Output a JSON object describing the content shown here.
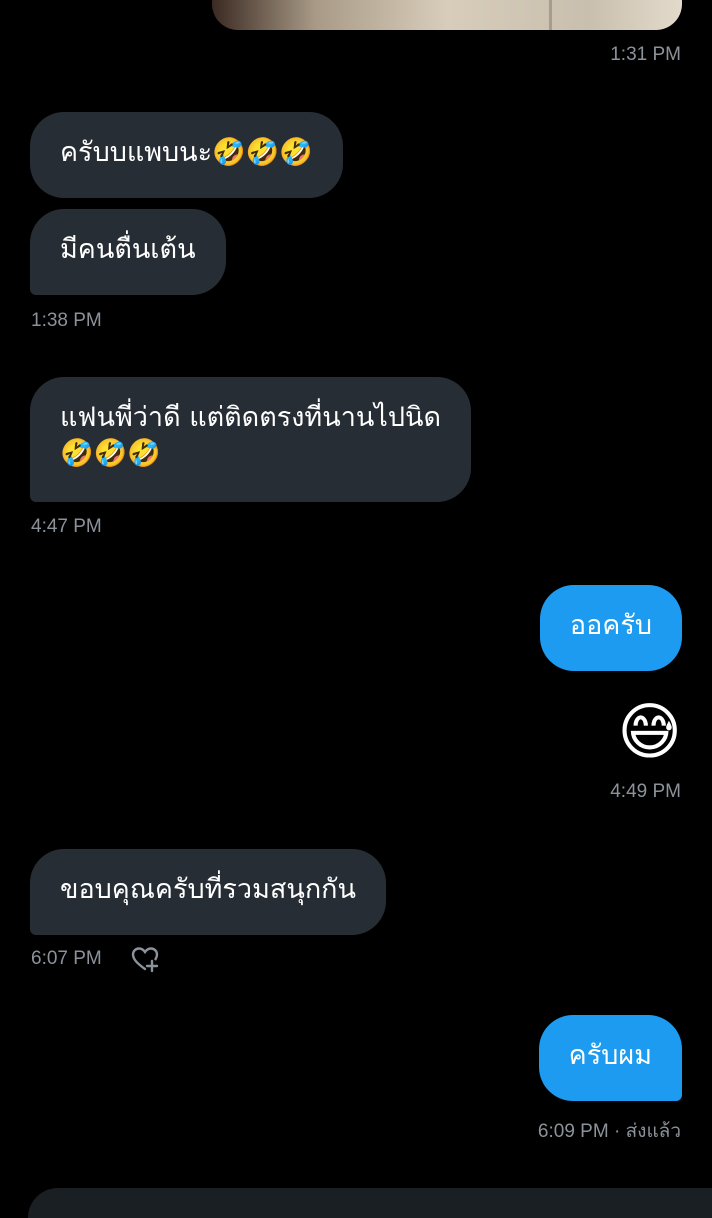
{
  "messages": [
    {
      "text": "ครับบแพบนะ🤣🤣🤣"
    },
    {
      "text": "มีคนตื่นเต้น"
    },
    {
      "line1": "แฟนพี่ว่าดี แต่ติดตรงที่นานไปนิด",
      "line2": "🤣🤣🤣"
    },
    {
      "text": "ออครับ"
    },
    {
      "text": "😅"
    },
    {
      "text": "ขอบคุณครับที่รวมสนุกกัน"
    },
    {
      "text": "ครับผม"
    }
  ],
  "timestamps": {
    "t1": "1:31 PM",
    "t2": "1:38 PM",
    "t3": "4:47 PM",
    "t4": "4:49 PM",
    "t5": "6:07 PM",
    "t6": "6:09 PM · ส่งแล้ว"
  },
  "colors": {
    "background": "#000000",
    "incoming_bubble": "#262d34",
    "outgoing_bubble": "#1d9bf0",
    "timestamp": "#8b9299"
  },
  "icons": {
    "react": "heart-plus-icon"
  }
}
